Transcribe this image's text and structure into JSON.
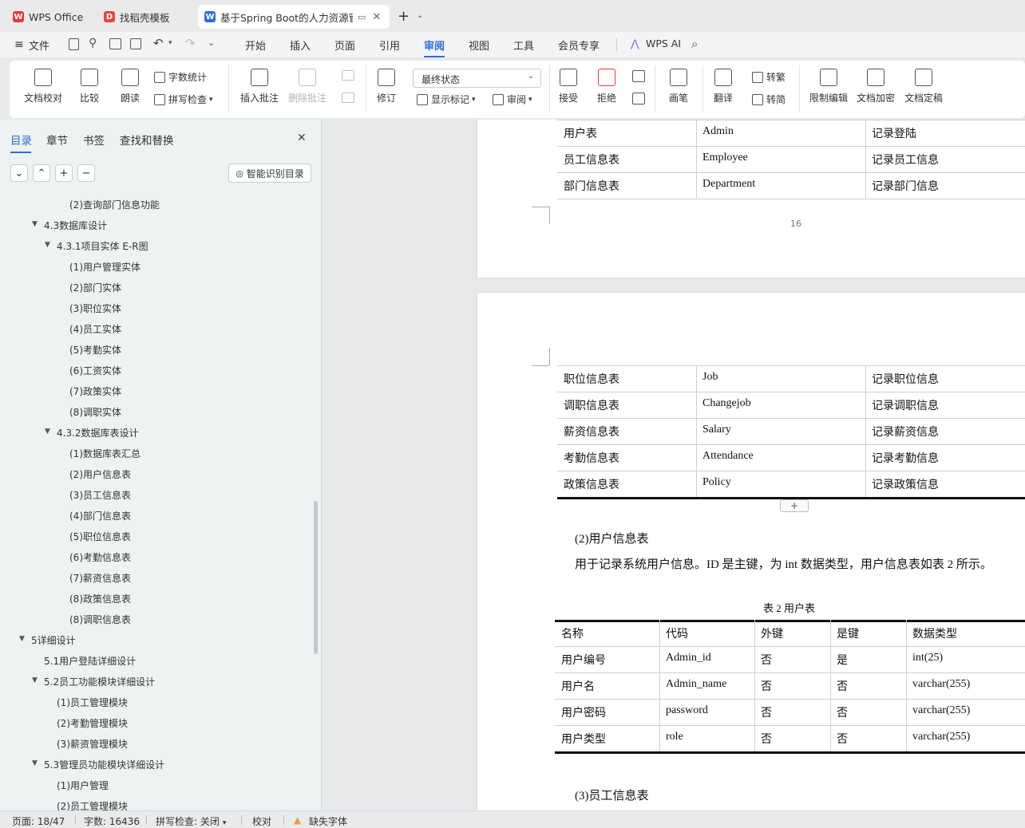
{
  "tabs": [
    {
      "label": "WPS Office"
    },
    {
      "label": "找稻壳模板"
    },
    {
      "label": "基于Spring Boot的人力资源管"
    }
  ],
  "menu": {
    "file": "文件",
    "items": [
      "开始",
      "插入",
      "页面",
      "引用",
      "审阅",
      "视图",
      "工具",
      "会员专享"
    ],
    "ai": "WPS AI"
  },
  "ribbon": {
    "proofread": "文档校对",
    "compare": "比较",
    "read_aloud": "朗读",
    "word_count": "字数统计",
    "spell_check": "拼写检查",
    "insert_comment": "插入批注",
    "delete_comment": "删除批注",
    "revise": "修订",
    "status_select": "最终状态",
    "show_marks": "显示标记",
    "review": "审阅",
    "accept": "接受",
    "reject": "拒绝",
    "pen": "画笔",
    "translate": "翻译",
    "to_traditional": "转繁",
    "to_simplified": "转简",
    "restrict_edit": "限制编辑",
    "encrypt": "文档加密",
    "finalize": "文档定稿"
  },
  "sidebar": {
    "tabs": [
      "目录",
      "章节",
      "书签",
      "查找和替换"
    ],
    "smart_btn": "智能识别目录",
    "toc": [
      {
        "text": "(2)查询部门信息功能",
        "level": 3,
        "arrow": ""
      },
      {
        "text": "4.3数据库设计",
        "level": 1,
        "arrow": "open"
      },
      {
        "text": "4.3.1项目实体 E-R图",
        "level": 2,
        "arrow": "open"
      },
      {
        "text": "(1)用户管理实体",
        "level": 3,
        "arrow": ""
      },
      {
        "text": "(2)部门实体",
        "level": 3,
        "arrow": ""
      },
      {
        "text": "(3)职位实体",
        "level": 3,
        "arrow": ""
      },
      {
        "text": "(4)员工实体",
        "level": 3,
        "arrow": ""
      },
      {
        "text": "(5)考勤实体",
        "level": 3,
        "arrow": ""
      },
      {
        "text": "(6)工资实体",
        "level": 3,
        "arrow": ""
      },
      {
        "text": "(7)政策实体",
        "level": 3,
        "arrow": ""
      },
      {
        "text": "(8)调职实体",
        "level": 3,
        "arrow": ""
      },
      {
        "text": "4.3.2数据库表设计",
        "level": 2,
        "arrow": "open"
      },
      {
        "text": "(1)数据库表汇总",
        "level": 3,
        "arrow": ""
      },
      {
        "text": "(2)用户信息表",
        "level": 3,
        "arrow": ""
      },
      {
        "text": "(3)员工信息表",
        "level": 3,
        "arrow": ""
      },
      {
        "text": "(4)部门信息表",
        "level": 3,
        "arrow": ""
      },
      {
        "text": "(5)职位信息表",
        "level": 3,
        "arrow": ""
      },
      {
        "text": "(6)考勤信息表",
        "level": 3,
        "arrow": ""
      },
      {
        "text": "(7)薪资信息表",
        "level": 3,
        "arrow": ""
      },
      {
        "text": "(8)政策信息表",
        "level": 3,
        "arrow": ""
      },
      {
        "text": "(8)调职信息表",
        "level": 3,
        "arrow": ""
      },
      {
        "text": "5详细设计",
        "level": 0,
        "arrow": "open"
      },
      {
        "text": "5.1用户登陆详细设计",
        "level": 1,
        "arrow": ""
      },
      {
        "text": "5.2员工功能模块详细设计",
        "level": 1,
        "arrow": "open"
      },
      {
        "text": "(1)员工管理模块",
        "level": 2,
        "arrow": ""
      },
      {
        "text": "(2)考勤管理模块",
        "level": 2,
        "arrow": ""
      },
      {
        "text": "(3)薪资管理模块",
        "level": 2,
        "arrow": ""
      },
      {
        "text": "5.3管理员功能模块详细设计",
        "level": 1,
        "arrow": "open"
      },
      {
        "text": "(1)用户管理",
        "level": 2,
        "arrow": ""
      },
      {
        "text": "(2)员工管理模块",
        "level": 2,
        "arrow": ""
      }
    ]
  },
  "document": {
    "page_number": "16",
    "table1_rows": [
      [
        "用户表",
        "Admin",
        "记录登陆"
      ],
      [
        "员工信息表",
        "Employee",
        "记录员工信息"
      ],
      [
        "部门信息表",
        "Department",
        "记录部门信息"
      ]
    ],
    "table1b_rows": [
      [
        "职位信息表",
        "Job",
        "记录职位信息"
      ],
      [
        "调职信息表",
        "Changejob",
        "记录调职信息"
      ],
      [
        "薪资信息表",
        "Salary",
        "记录薪资信息"
      ],
      [
        "考勤信息表",
        "Attendance",
        "记录考勤信息"
      ],
      [
        "政策信息表",
        "Policy",
        "记录政策信息"
      ]
    ],
    "heading_user": "(2)用户信息表",
    "para_user": "用于记录系统用户信息。ID 是主键，为 int 数据类型，用户信息表如表 2 所示。",
    "table2_caption": "表 2  用户表",
    "table2_header": [
      "名称",
      "代码",
      "外键",
      "是键",
      "数据类型"
    ],
    "table2_rows": [
      [
        "用户编号",
        "Admin_id",
        "否",
        "是",
        "int(25)"
      ],
      [
        "用户名",
        "Admin_name",
        "否",
        "否",
        "varchar(255)"
      ],
      [
        "用户密码",
        "password",
        "否",
        "否",
        "varchar(255)"
      ],
      [
        "用户类型",
        "role",
        "否",
        "否",
        "varchar(255)"
      ]
    ],
    "heading_emp": "(3)员工信息表"
  },
  "status": {
    "page": "页面: 18/47",
    "words": "字数: 16436",
    "spell": "拼写检查: 关闭",
    "proof": "校对",
    "missing_font": "缺失字体"
  }
}
